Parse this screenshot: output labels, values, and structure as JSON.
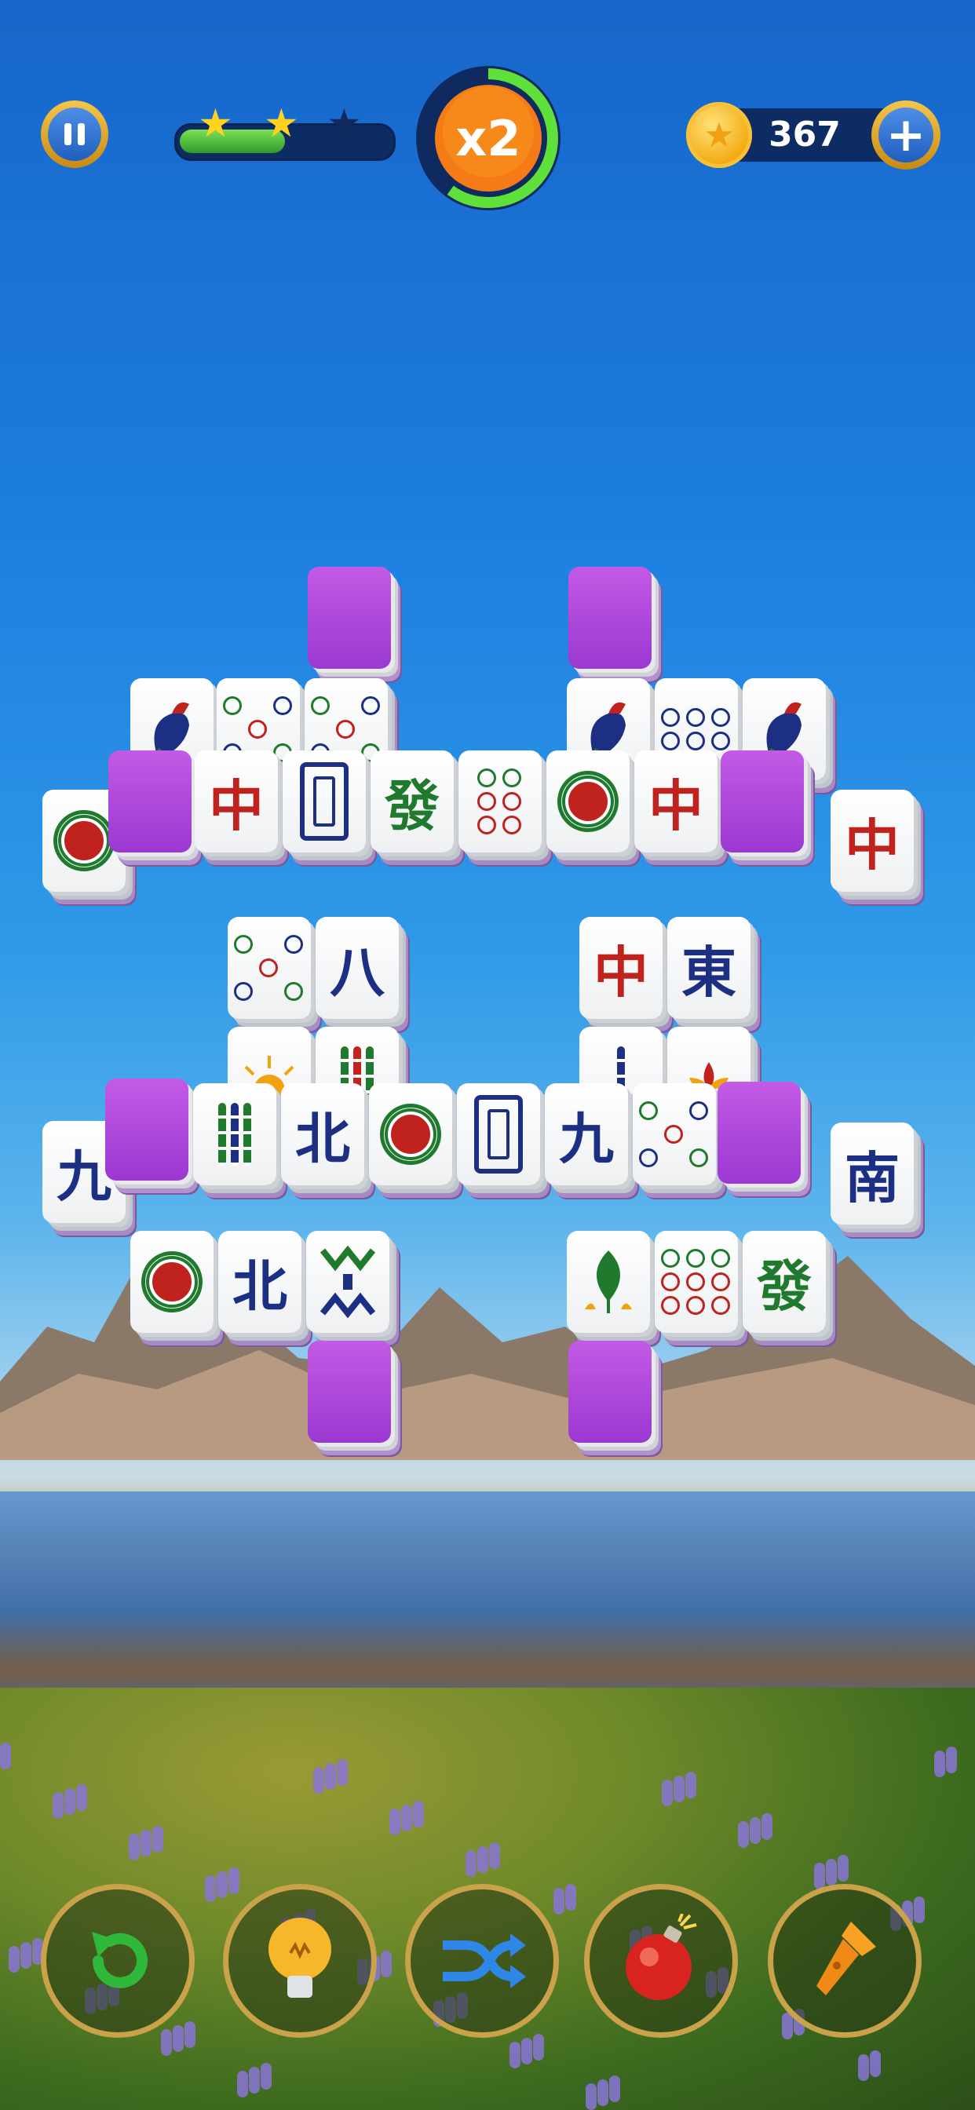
{
  "hud": {
    "pause_label": "",
    "stars_earned": 2,
    "stars_total": 3,
    "level_progress": 0.5,
    "multiplier": "x2",
    "multiplier_timer_fraction": 0.6,
    "coins": "367"
  },
  "tiles": [
    {
      "g": "中",
      "c": "red"
    },
    {
      "g": "發",
      "c": "green"
    },
    {
      "g": "八",
      "c": "blue"
    },
    {
      "g": "中",
      "c": "red"
    },
    {
      "g": "東",
      "c": "blue"
    },
    {
      "g": "北",
      "c": "blue"
    },
    {
      "g": "九",
      "c": "blue"
    },
    {
      "g": "九",
      "c": "blue"
    },
    {
      "g": "北",
      "c": "blue"
    },
    {
      "g": "南",
      "c": "blue"
    },
    {
      "g": "中",
      "c": "red"
    },
    {
      "g": "發",
      "c": "green"
    },
    {
      "g": "中",
      "c": "red"
    }
  ],
  "tools": [
    "undo-icon",
    "hint-bulb-icon",
    "shuffle-icon",
    "bomb-icon",
    "flashlight-icon"
  ],
  "colors": {
    "accent": "#f7941d",
    "progress": "#3fae33",
    "tile_locked": "#b149dc",
    "frame_gold": "#c9a24a"
  }
}
